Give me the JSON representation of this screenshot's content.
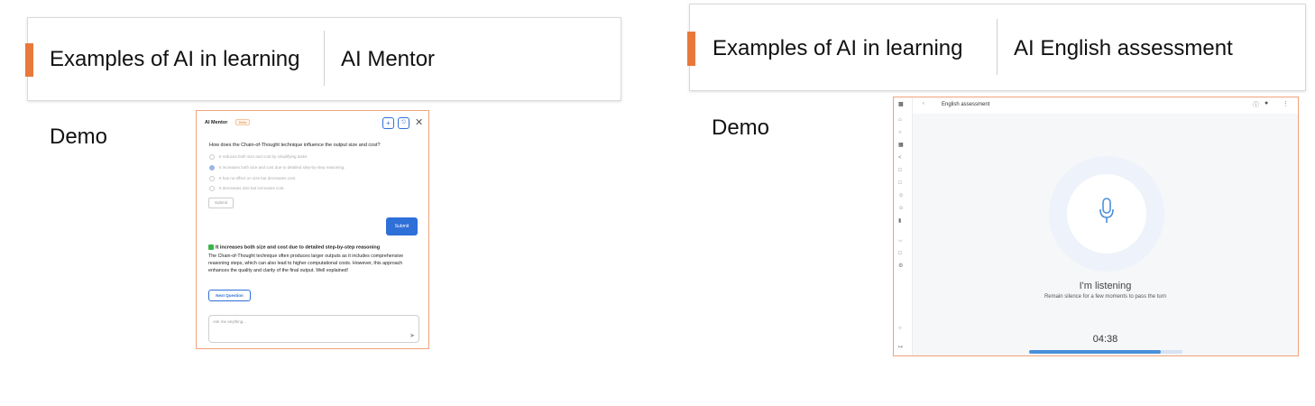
{
  "left_card": {
    "section_label": "Examples of AI in learning",
    "title": "AI Mentor",
    "demo_label": "Demo"
  },
  "right_card": {
    "section_label": "Examples of AI in learning",
    "title": "AI English assessment",
    "demo_label": "Demo"
  },
  "mentor": {
    "header": "AI Mentor",
    "beta": "Beta",
    "question": "How does the Chain-of-Thought technique influence the output size and cost?",
    "options": [
      "It reduces both size and cost by simplifying tasks.",
      "It increases both size and cost due to detailed step-by-step reasoning.",
      "It has no effect on size but decreases cost.",
      "It decreases size but increases cost."
    ],
    "selected_option_index": 1,
    "submit_light": "Submit",
    "submit_blue": "Submit",
    "answer_title": "It increases both size and cost due to detailed step-by-step reasoning",
    "explanation": "The Chain-of-Thought technique often produces larger outputs as it includes comprehensive reasoning steps, which can also lead to higher computational costs. However, this approach enhances the quality and clarity of the final output. Well explained!",
    "next_button": "Next Question",
    "input_placeholder": "Ask me anything..."
  },
  "assessment": {
    "page_title": "English assessment",
    "status": "I'm listening",
    "hint": "Remain silence for a few moments to pass the turn",
    "timer": "04:38",
    "progress_fraction": 0.86,
    "accent_color": "#4a90d9"
  }
}
